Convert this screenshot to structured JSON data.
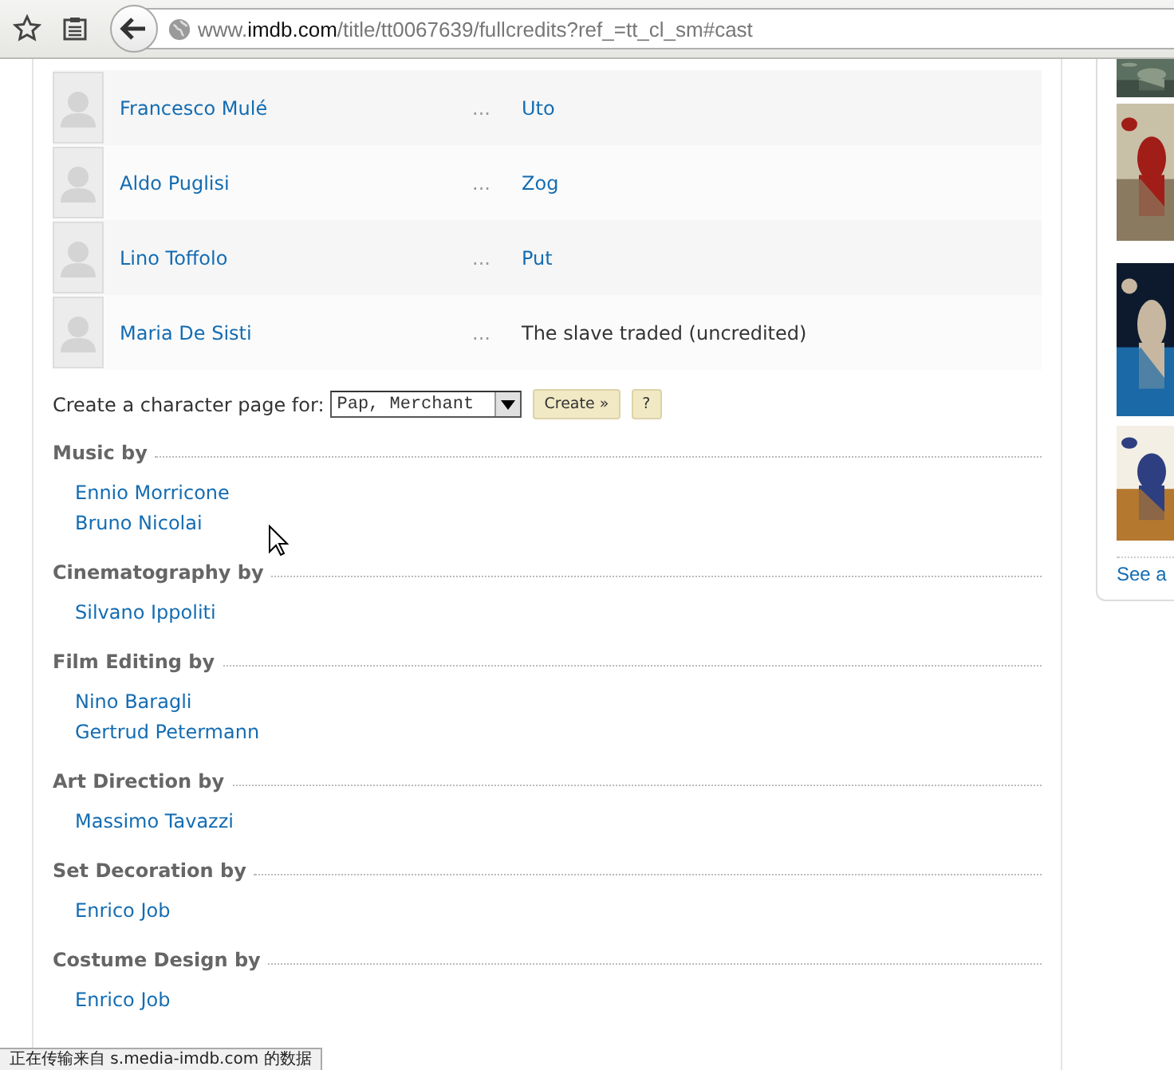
{
  "browser": {
    "url_prefix": "www.",
    "url_domain": "imdb.com",
    "url_path": "/title/tt0067639/fullcredits?ref_=tt_cl_sm#cast"
  },
  "cast": [
    {
      "name": "Francesco Mulé",
      "separator": "...",
      "character": "Uto",
      "linked": true
    },
    {
      "name": "Aldo Puglisi",
      "separator": "...",
      "character": "Zog",
      "linked": true
    },
    {
      "name": "Lino Toffolo",
      "separator": "...",
      "character": "Put",
      "linked": true
    },
    {
      "name": "Maria De Sisti",
      "separator": "...",
      "character": "The slave traded (uncredited)",
      "linked": false
    }
  ],
  "character_page": {
    "label": "Create a character page for:",
    "value": "Pap, Merchant",
    "create_button": "Create »",
    "help_button": "?"
  },
  "sections": [
    {
      "title": "Music by",
      "people": [
        "Ennio Morricone",
        "Bruno Nicolai"
      ]
    },
    {
      "title": "Cinematography by",
      "people": [
        "Silvano Ippoliti"
      ]
    },
    {
      "title": "Film Editing by",
      "people": [
        "Nino Baragli",
        "Gertrud Petermann"
      ]
    },
    {
      "title": "Art Direction by",
      "people": [
        "Massimo Tavazzi"
      ]
    },
    {
      "title": "Set Decoration by",
      "people": [
        "Enrico Job"
      ]
    },
    {
      "title": "Costume Design by",
      "people": [
        "Enrico Job"
      ]
    }
  ],
  "sidebar": {
    "link": "See a"
  },
  "status_bar": "正在传输来自 s.media-imdb.com 的数据"
}
